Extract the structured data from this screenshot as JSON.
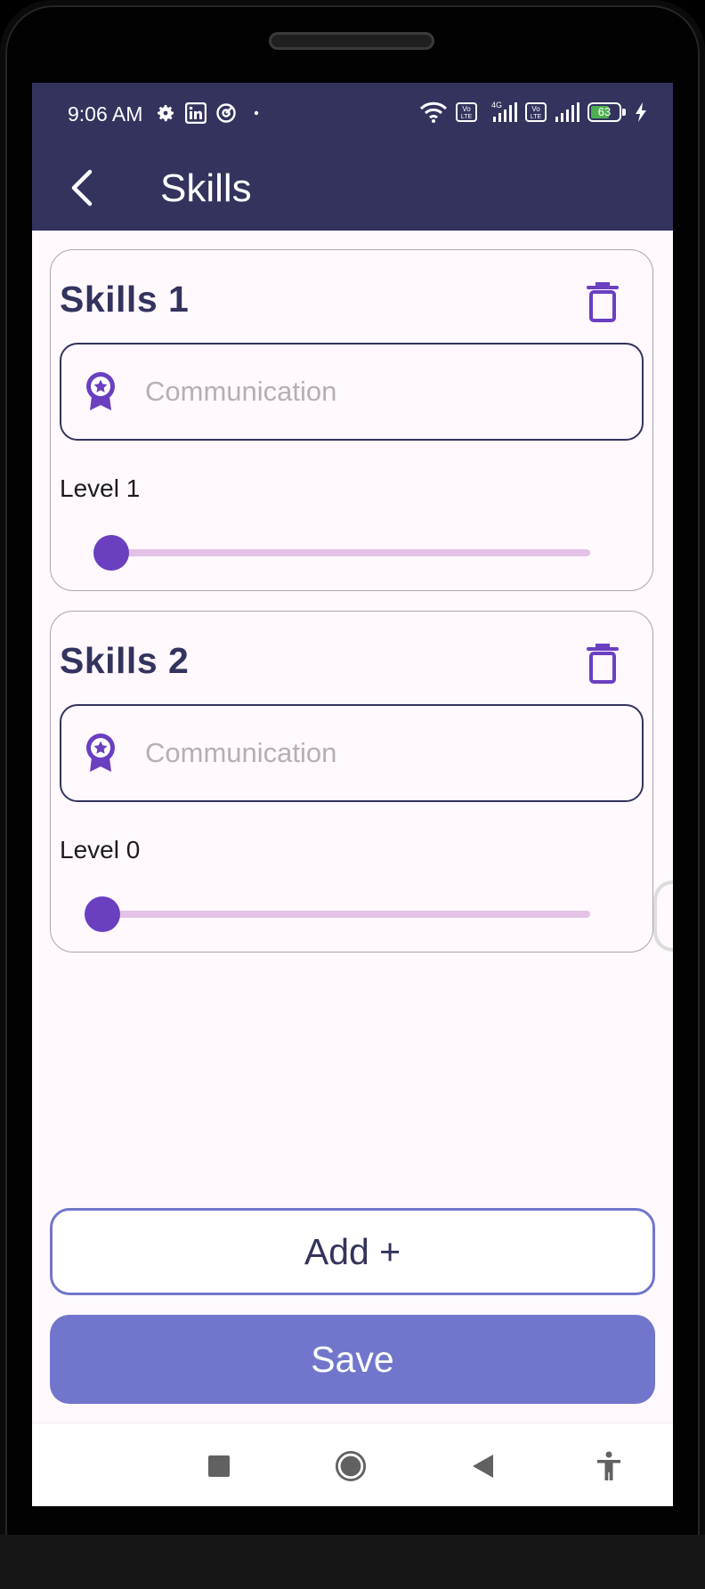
{
  "status_bar": {
    "time": "9:06 AM",
    "battery_level": "63",
    "left_icons": [
      "settings-gear-icon",
      "linkedin-icon",
      "circle-at-icon",
      "dot-icon"
    ],
    "right_icons": [
      "wifi-icon",
      "volte-icon",
      "4g-signal-icon",
      "volte-icon",
      "signal-icon",
      "battery-icon",
      "charging-icon"
    ]
  },
  "app_bar": {
    "title": "Skills",
    "back_icon": "chevron-left-icon",
    "color": "#33335E"
  },
  "skills": [
    {
      "title": "Skills 1",
      "input_placeholder": "Communication",
      "input_value": "",
      "level_label": "Level 1",
      "level": 1,
      "slider_min": 0,
      "slider_max": 10
    },
    {
      "title": "Skills 2",
      "input_placeholder": "Communication",
      "input_value": "",
      "level_label": "Level 0",
      "level": 0,
      "slider_min": 0,
      "slider_max": 10
    }
  ],
  "buttons": {
    "add_label": "Add +",
    "save_label": "Save"
  },
  "colors": {
    "accent": "#6A3FC0",
    "primary": "#33335E",
    "button": "#7176CC",
    "slider_track": "#E3C2E6",
    "background": "#FFF8FD"
  },
  "nav_bar": {
    "icons": [
      "recents-square-icon",
      "home-circle-icon",
      "back-triangle-icon",
      "accessibility-icon"
    ]
  }
}
